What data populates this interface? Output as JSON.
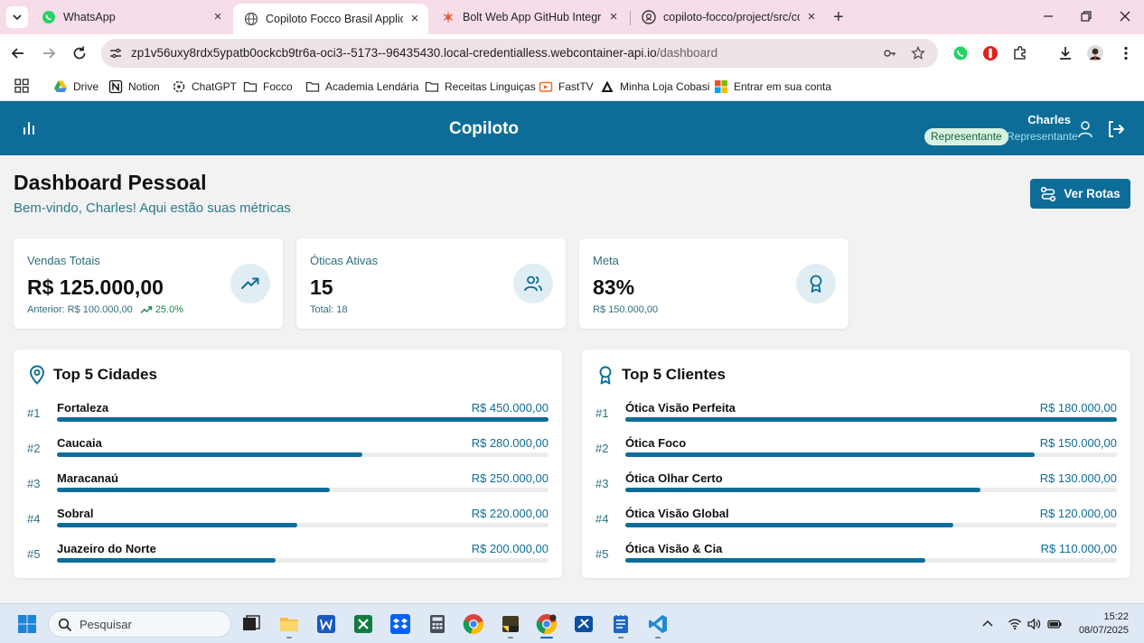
{
  "browser": {
    "tabs": [
      {
        "title": "WhatsApp",
        "icon": "whatsapp-icon",
        "active": false
      },
      {
        "title": "Copiloto Focco Brasil Applicatio",
        "icon": "globe-icon",
        "active": true
      },
      {
        "title": "Bolt Web App GitHub Integratic",
        "icon": "bolt-icon",
        "active": false
      },
      {
        "title": "copiloto-focco/project/src/com",
        "icon": "github-icon",
        "active": false
      }
    ],
    "url_host": "zp1v56uxy8rdx5ypatb0ockcb9tr6a-oci3--5173--96435430.local-credentialless.webcontainer-api.io",
    "url_path": "/dashboard",
    "bookmarks": [
      {
        "label": "Drive",
        "icon": "drive-icon"
      },
      {
        "label": "Notion",
        "icon": "notion-icon"
      },
      {
        "label": "ChatGPT",
        "icon": "chatgpt-icon"
      },
      {
        "label": "Focco",
        "icon": "folder-icon"
      },
      {
        "label": "Academia Lendária",
        "icon": "folder-icon"
      },
      {
        "label": "Receitas Linguiças",
        "icon": "folder-icon"
      },
      {
        "label": "FastTV",
        "icon": "fasttv-icon"
      },
      {
        "label": "Minha Loja Cobasi",
        "icon": "cobasi-icon"
      },
      {
        "label": "Entrar em sua conta",
        "icon": "microsoft-icon"
      }
    ]
  },
  "app": {
    "title": "Copiloto",
    "user": {
      "name": "Charles",
      "badge": "Representante",
      "role": "Representante"
    },
    "brand_color": "#0d6d98"
  },
  "page": {
    "title": "Dashboard Pessoal",
    "subtitle": "Bem-vindo, Charles! Aqui estão suas métricas",
    "routes_button": "Ver Rotas"
  },
  "metrics": [
    {
      "label": "Vendas Totais",
      "value": "R$ 125.000,00",
      "sub": "Anterior: R$ 100.000,00",
      "trend": "25.0%",
      "icon": "trending-up-icon"
    },
    {
      "label": "Óticas Ativas",
      "value": "15",
      "sub": "Total: 18",
      "icon": "users-icon"
    },
    {
      "label": "Meta",
      "value": "83%",
      "sub": "R$ 150.000,00",
      "icon": "award-icon"
    }
  ],
  "top_cities": {
    "title": "Top 5 Cidades",
    "icon": "map-pin-icon",
    "items": [
      {
        "rank": "#1",
        "name": "Fortaleza",
        "value": "R$ 450.000,00",
        "share": 1.0
      },
      {
        "rank": "#2",
        "name": "Caucaia",
        "value": "R$ 280.000,00",
        "share": 0.622
      },
      {
        "rank": "#3",
        "name": "Maracanaú",
        "value": "R$ 250.000,00",
        "share": 0.556
      },
      {
        "rank": "#4",
        "name": "Sobral",
        "value": "R$ 220.000,00",
        "share": 0.489
      },
      {
        "rank": "#5",
        "name": "Juazeiro do Norte",
        "value": "R$ 200.000,00",
        "share": 0.444
      }
    ]
  },
  "top_clients": {
    "title": "Top 5 Clientes",
    "icon": "award-icon",
    "items": [
      {
        "rank": "#1",
        "name": "Ótica Visão Perfeita",
        "value": "R$ 180.000,00",
        "share": 1.0
      },
      {
        "rank": "#2",
        "name": "Ótica Foco",
        "value": "R$ 150.000,00",
        "share": 0.833
      },
      {
        "rank": "#3",
        "name": "Ótica Olhar Certo",
        "value": "R$ 130.000,00",
        "share": 0.722
      },
      {
        "rank": "#4",
        "name": "Ótica Visão Global",
        "value": "R$ 120.000,00",
        "share": 0.667
      },
      {
        "rank": "#5",
        "name": "Ótica Visão & Cia",
        "value": "R$ 110.000,00",
        "share": 0.611
      }
    ]
  },
  "taskbar": {
    "search_placeholder": "Pesquisar",
    "apps": [
      "task-view-icon",
      "file-explorer-icon",
      "word-icon",
      "excel-icon",
      "dropbox-icon",
      "calculator-icon",
      "chrome-icon",
      "sticky-notes-icon",
      "chrome-profile-icon",
      "snip-icon",
      "notepad-icon",
      "vscode-icon"
    ],
    "time": "15:22",
    "date": "08/07/2025"
  }
}
